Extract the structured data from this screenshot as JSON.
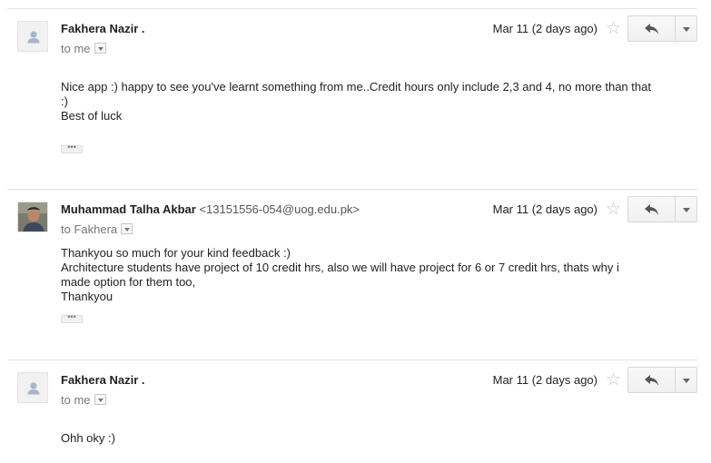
{
  "messages": [
    {
      "sender": "Fakhera Nazir .",
      "email": "",
      "recipient": "to me",
      "date": "Mar 11 (2 days ago)",
      "avatar": "default-avatar-icon",
      "body": [
        "Nice app :) happy to see you've learnt something from me..Credit hours only include 2,3 and 4, no more than that :)",
        "Best of luck"
      ],
      "has_trimmed": true
    },
    {
      "sender": "Muhammad Talha Akbar",
      "email": "<13151556-054@uog.edu.pk>",
      "recipient": "to Fakhera",
      "date": "Mar 11 (2 days ago)",
      "avatar": "profile-photo",
      "body": [
        "Thankyou so much for your kind feedback :)",
        "Architecture students have project of 10 credit hrs, also we will have project for 6 or 7 credit hrs, thats why i made option for them too,",
        "Thankyou"
      ],
      "has_trimmed": true
    },
    {
      "sender": "Fakhera Nazir .",
      "email": "",
      "recipient": "to me",
      "date": "Mar 11 (2 days ago)",
      "avatar": "default-avatar-icon",
      "body": [
        "Ohh oky :)"
      ],
      "has_trimmed": false
    }
  ],
  "icons": {
    "star": "star-icon",
    "reply": "reply-icon",
    "more": "chevron-down-icon",
    "ellipsis": "show-trimmed-content-icon"
  },
  "colors": {
    "divider": "#e5e5e5",
    "button_border": "#d8d8d8",
    "muted_text": "#777777",
    "avatar_bg": "#f1f1f1",
    "avatar_glyph": "#aab4c8"
  }
}
